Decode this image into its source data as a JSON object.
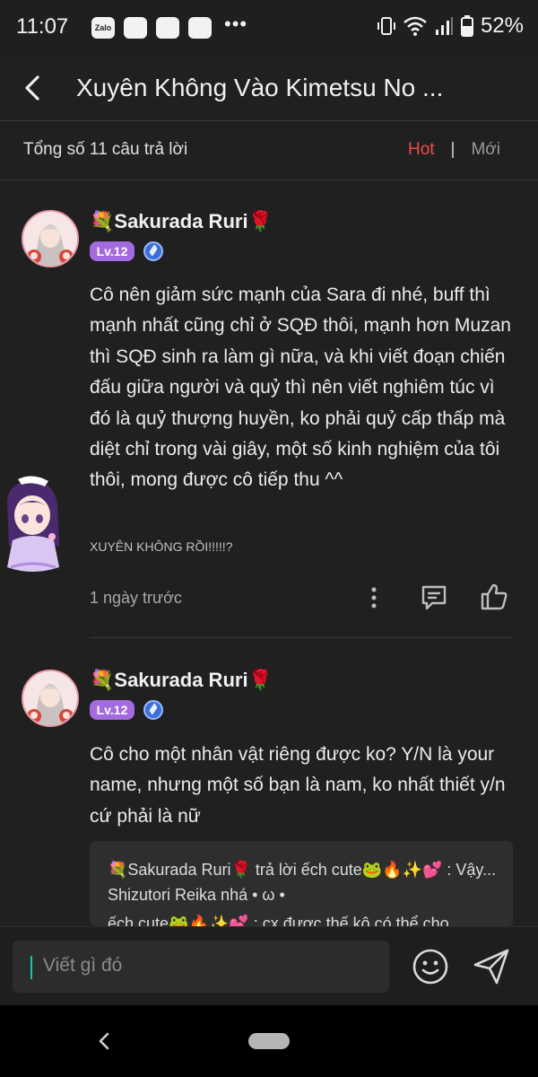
{
  "status_bar": {
    "time": "11:07",
    "zalo_label": "Zalo",
    "dots": "•••",
    "battery": "52%"
  },
  "header": {
    "title": "Xuyên Không Vào Kimetsu No ..."
  },
  "summary": {
    "count_text": "Tổng số 11 câu trả lời",
    "sort_hot": "Hot",
    "sort_separator": "|",
    "sort_new": "Mới",
    "active_color": "#ef4d4d"
  },
  "comments": [
    {
      "username": "💐Sakurada Ruri🌹",
      "level": "Lv.12",
      "body": "Cô nên giảm sức mạnh của Sara đi nhé, buff thì mạnh nhất cũng chỉ ở SQĐ thôi, mạnh hơn Muzan thì SQĐ sinh ra làm gì nữa, và khi viết đoạn chiến đấu giữa người và quỷ thì nên viết nghiêm túc vì đó là quỷ thượng huyền, ko phải quỷ cấp thấp mà diệt chỉ trong vài giây, một số kinh nghiệm của tôi thôi, mong được cô tiếp thu ^^",
      "tag": "XUYÊN KHÔNG RỒI!!!!!?",
      "time": "1 ngày trước"
    },
    {
      "username": "💐Sakurada Ruri🌹",
      "level": "Lv.12",
      "body": "Cô cho một nhân vật riêng được ko? Y/N là your name, nhưng một số bạn là nam, ko nhất thiết y/n cứ phải là nữ",
      "replies": [
        "💐Sakurada Ruri🌹 trả lời ếch cute🐸🔥✨💕 : Vậy... Shizutori Reika nhá • ω •",
        "ếch cute🐸🔥✨💕 : cx được thế kô có thể cho"
      ]
    }
  ],
  "input": {
    "placeholder": "Viết gì đó"
  },
  "icons": {
    "back": "back-chevron-icon",
    "more": "more-vertical-icon",
    "reply": "comment-icon",
    "like": "thumbs-up-icon",
    "emoji": "smiley-icon",
    "send": "send-icon",
    "badge": "ethereum-badge-icon"
  },
  "colors": {
    "background": "#202020",
    "accent_red": "#ef4d4d",
    "level_purple": "#a46ae0",
    "badge_blue": "#3d6fd8"
  }
}
